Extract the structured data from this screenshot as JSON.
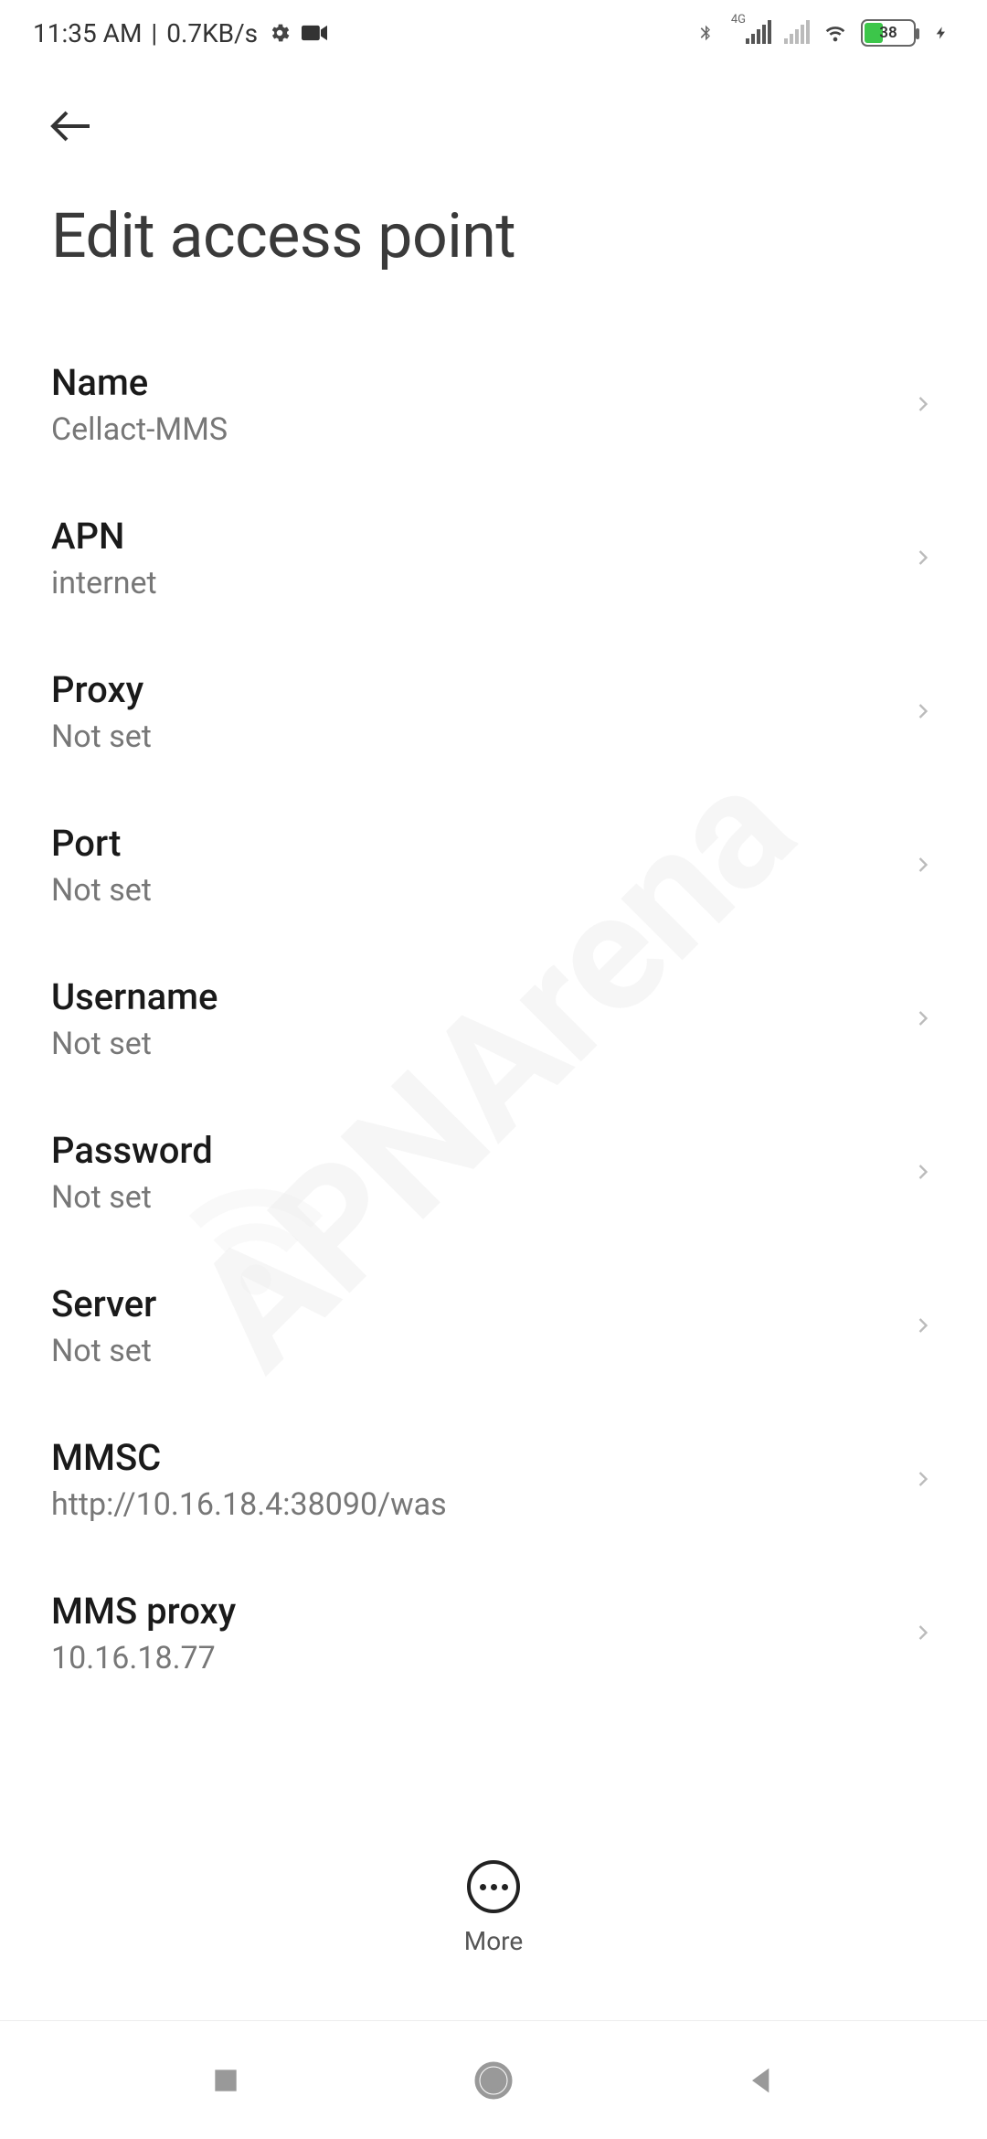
{
  "statusbar": {
    "time": "11:35 AM",
    "netspeed": "0.7KB/s",
    "signal_label": "4G",
    "battery_percent": "38"
  },
  "header": {
    "title": "Edit access point"
  },
  "fields": {
    "name": {
      "label": "Name",
      "value": "Cellact-MMS"
    },
    "apn": {
      "label": "APN",
      "value": "internet"
    },
    "proxy": {
      "label": "Proxy",
      "value": "Not set"
    },
    "port": {
      "label": "Port",
      "value": "Not set"
    },
    "username": {
      "label": "Username",
      "value": "Not set"
    },
    "password": {
      "label": "Password",
      "value": "Not set"
    },
    "server": {
      "label": "Server",
      "value": "Not set"
    },
    "mmsc": {
      "label": "MMSC",
      "value": "http://10.16.18.4:38090/was"
    },
    "mmsproxy": {
      "label": "MMS proxy",
      "value": "10.16.18.77"
    }
  },
  "footer": {
    "more_label": "More"
  },
  "watermark": {
    "text": "APNArena"
  }
}
